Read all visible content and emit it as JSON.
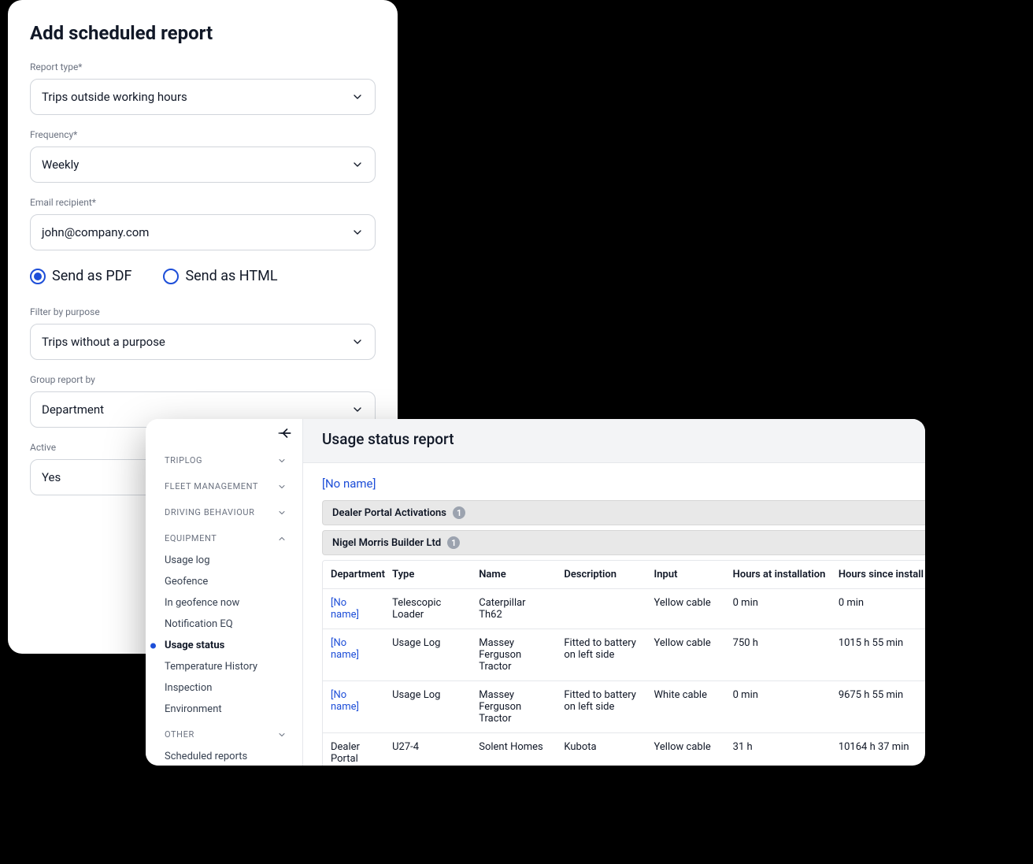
{
  "form": {
    "title": "Add scheduled report",
    "fields": {
      "report_type": {
        "label": "Report type*",
        "value": "Trips outside working hours"
      },
      "frequency": {
        "label": "Frequency*",
        "value": "Weekly"
      },
      "email_recipient": {
        "label": "Email recipient*",
        "value": "john@company.com"
      },
      "filter_purpose": {
        "label": "Filter by purpose",
        "value": "Trips without a purpose"
      },
      "group_by": {
        "label": "Group report by",
        "value": "Department"
      },
      "active": {
        "label": "Active",
        "value": "Yes"
      }
    },
    "radios": {
      "pdf": "Send as PDF",
      "html": "Send as HTML"
    }
  },
  "report": {
    "title": "Usage status report",
    "no_name": "[No name]",
    "sidebar": {
      "sections": {
        "triplog": "TRIPLOG",
        "fleet": "FLEET MANAGEMENT",
        "driving": "DRIVING BEHAVIOUR",
        "equipment": "EQUIPMENT",
        "other": "OTHER"
      },
      "equipment_items": [
        "Usage log",
        "Geofence",
        "In geofence now",
        "Notification EQ",
        "Usage status",
        "Temperature History",
        "Inspection",
        "Environment"
      ],
      "other_items": [
        "Scheduled reports"
      ]
    },
    "groups": [
      {
        "label": "Dealer Portal Activations",
        "count": "1"
      },
      {
        "label": "Nigel Morris Builder Ltd",
        "count": "1"
      }
    ],
    "columns": {
      "department": "Department",
      "type": "Type",
      "name": "Name",
      "description": "Description",
      "input": "Input",
      "hours_install": "Hours at installation",
      "hours_since": "Hours since install"
    },
    "rows": [
      {
        "department": "[No name]",
        "dept_link": true,
        "type": "Telescopic Loader",
        "name": "Caterpillar Th62",
        "description": "",
        "input": "Yellow cable",
        "hours_install": "0 min",
        "hours_since": "0 min"
      },
      {
        "department": "[No name]",
        "dept_link": true,
        "type": "Usage Log",
        "name": "Massey Ferguson Tractor",
        "description": "Fitted to battery on left side",
        "input": "Yellow cable",
        "hours_install": "750 h",
        "hours_since": "1015 h 55 min"
      },
      {
        "department": "[No name]",
        "dept_link": true,
        "type": "Usage Log",
        "name": "Massey Ferguson Tractor",
        "description": "Fitted to battery on left side",
        "input": "White cable",
        "hours_install": "0 min",
        "hours_since": "9675 h 55 min"
      },
      {
        "department": "Dealer Portal",
        "dept_link": false,
        "type": "U27-4",
        "name": "Solent Homes",
        "description": "Kubota",
        "input": "Yellow cable",
        "hours_install": "31 h",
        "hours_since": "10164 h 37 min"
      }
    ]
  }
}
